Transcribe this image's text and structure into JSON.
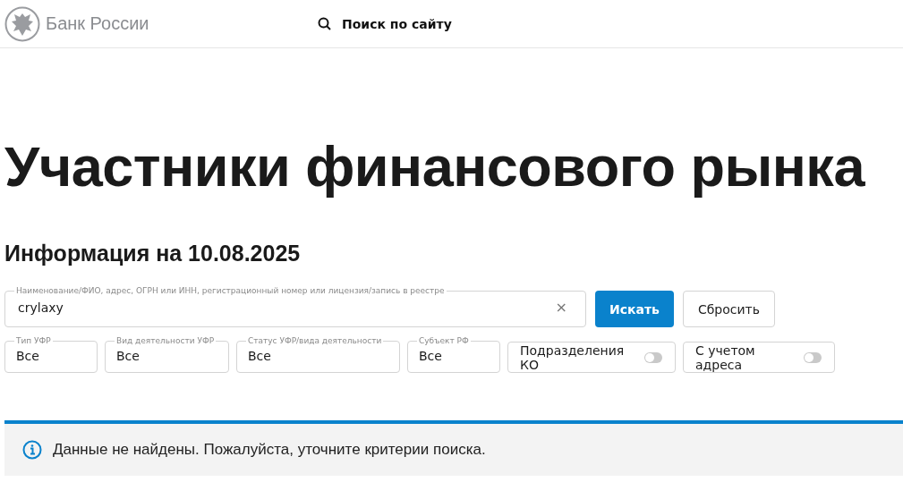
{
  "header": {
    "logo_text": "Банк России",
    "search_label": "Поиск по сайту"
  },
  "title": "Участники финансового рынка",
  "info_date": "Информация на 10.08.2025",
  "search": {
    "label": "Наименование/ФИО, адрес, ОГРН или ИНН, регистрационный номер или лицензия/запись в реестре",
    "value": "crylaxy",
    "clear": "×"
  },
  "buttons": [
    {
      "label": "Искать",
      "kind": "primary"
    },
    {
      "label": "Сбросить",
      "kind": "secondary"
    }
  ],
  "filters": [
    {
      "label": "Тип УФР",
      "value": "Все"
    },
    {
      "label": "Вид деятельности УФР",
      "value": "Все"
    },
    {
      "label": "Статус УФР/вида деятельности",
      "value": "Все"
    },
    {
      "label": "Субъект РФ",
      "value": "Все"
    }
  ],
  "toggles": [
    {
      "label": "Подразделения КО",
      "on": false
    },
    {
      "label": "С учетом адреса",
      "on": false
    }
  ],
  "alert": {
    "message": "Данные не найдены. Пожалуйста, уточните критерии поиска."
  }
}
